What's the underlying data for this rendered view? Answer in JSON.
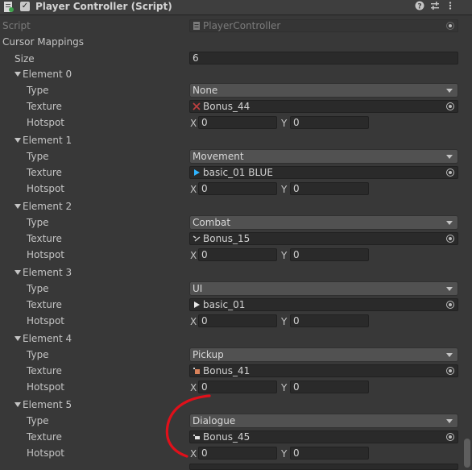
{
  "header": {
    "title": "Player Controller (Script)",
    "icons": [
      "help-icon",
      "presets-icon",
      "more-icon"
    ]
  },
  "script_row": {
    "label": "Script",
    "value": "PlayerController"
  },
  "list": {
    "label": "Cursor Mappings",
    "size_label": "Size",
    "size_value": "6",
    "labels": {
      "type": "Type",
      "texture": "Texture",
      "hotspot": "Hotspot",
      "x": "X",
      "y": "Y"
    },
    "elements": [
      {
        "name": "Element 0",
        "type": "None",
        "texture": "Bonus_44",
        "icon_color": "#c04040",
        "x": "0",
        "y": "0"
      },
      {
        "name": "Element 1",
        "type": "Movement",
        "texture": "basic_01 BLUE",
        "icon_color": "#2fb4ff",
        "x": "0",
        "y": "0"
      },
      {
        "name": "Element 2",
        "type": "Combat",
        "texture": "Bonus_15",
        "icon_color": "#d0d0d0",
        "x": "0",
        "y": "0"
      },
      {
        "name": "Element 3",
        "type": "UI",
        "texture": "basic_01",
        "icon_color": "#e8e8e8",
        "x": "0",
        "y": "0"
      },
      {
        "name": "Element 4",
        "type": "Pickup",
        "texture": "Bonus_41",
        "icon_color": "#d9825a",
        "x": "0",
        "y": "0"
      },
      {
        "name": "Element 5",
        "type": "Dialogue",
        "texture": "Bonus_45",
        "icon_color": "#e0e0e0",
        "x": "0",
        "y": "0"
      }
    ]
  },
  "annotation_color": "#e0101a"
}
